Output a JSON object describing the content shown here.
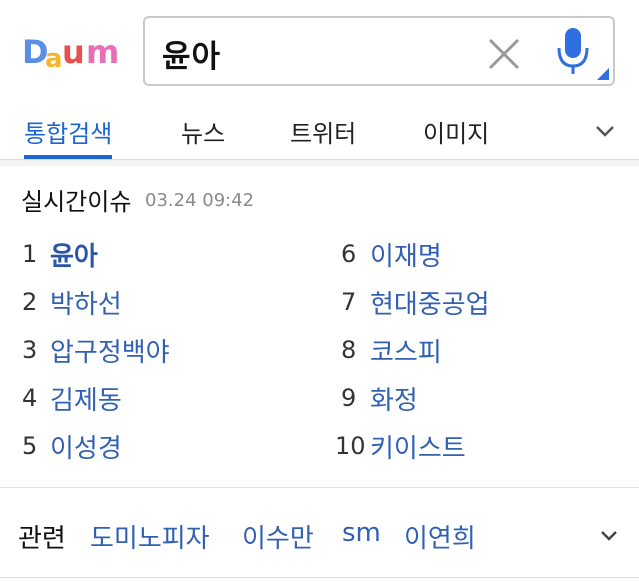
{
  "header": {
    "logo_text": "Daum",
    "search_value": "윤아"
  },
  "tabs": [
    {
      "label": "통합검색",
      "active": true
    },
    {
      "label": "뉴스",
      "active": false
    },
    {
      "label": "트위터",
      "active": false
    },
    {
      "label": "이미지",
      "active": false
    }
  ],
  "realtime": {
    "title": "실시간이슈",
    "timestamp": "03.24 09:42",
    "items": [
      {
        "rank": "1",
        "name": "윤아"
      },
      {
        "rank": "2",
        "name": "박하선"
      },
      {
        "rank": "3",
        "name": "압구정백야"
      },
      {
        "rank": "4",
        "name": "김제동"
      },
      {
        "rank": "5",
        "name": "이성경"
      },
      {
        "rank": "6",
        "name": "이재명"
      },
      {
        "rank": "7",
        "name": "현대중공업"
      },
      {
        "rank": "8",
        "name": "코스피"
      },
      {
        "rank": "9",
        "name": "화정"
      },
      {
        "rank": "10",
        "name": "키이스트"
      }
    ]
  },
  "related": {
    "label": "관련",
    "links": [
      "도미노피자",
      "이수만",
      "sm",
      "이연희"
    ]
  },
  "colors": {
    "accent": "#1c65d4",
    "link": "#3260b3",
    "logo_d": "#5b8ee6",
    "logo_a": "#f6b52d",
    "logo_u": "#e84f4f",
    "logo_m": "#e86fb5"
  },
  "icons": {
    "clear": "close-icon",
    "mic": "microphone-icon",
    "tabs_more": "chevron-down-icon",
    "related_more": "chevron-down-icon"
  }
}
